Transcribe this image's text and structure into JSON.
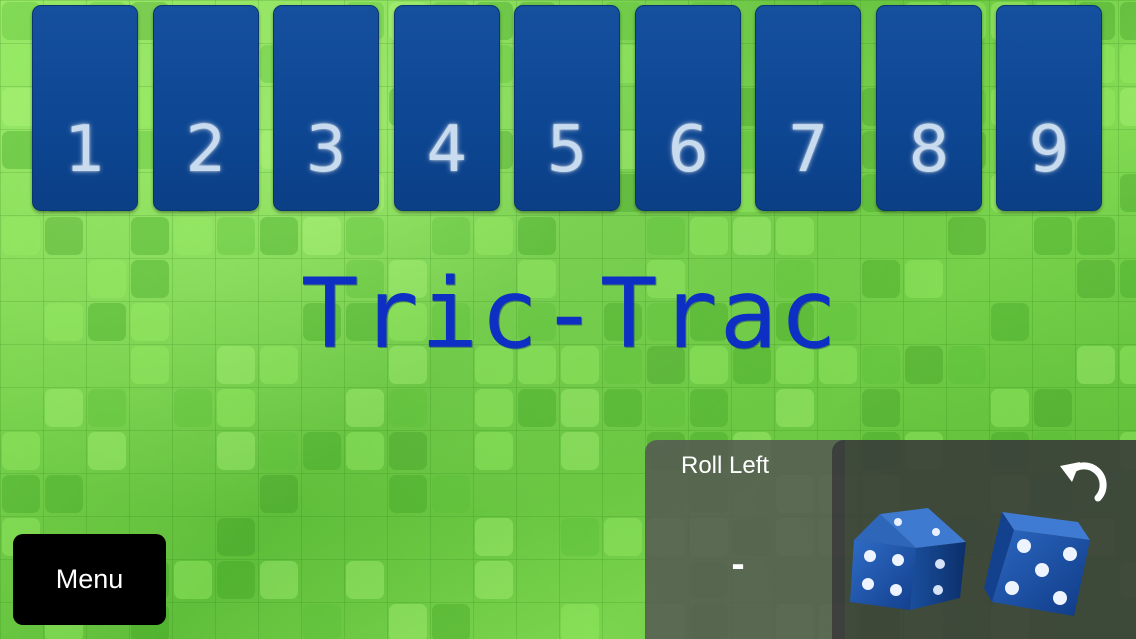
{
  "cards": [
    {
      "label": "1"
    },
    {
      "label": "2"
    },
    {
      "label": "3"
    },
    {
      "label": "4"
    },
    {
      "label": "5"
    },
    {
      "label": "6"
    },
    {
      "label": "7"
    },
    {
      "label": "8"
    },
    {
      "label": "9"
    }
  ],
  "title": "Tric-Trac",
  "menu": {
    "label": "Menu"
  },
  "roll": {
    "label": "Roll Left",
    "value": "-"
  },
  "dice": [
    {
      "value": 5
    },
    {
      "value": 5
    }
  ],
  "icons": {
    "undo": "undo-arrow-icon"
  },
  "colors": {
    "card": "#0d4692",
    "card_number": "#c9dbee",
    "title": "#0d2fc4",
    "die": "#1a56b0",
    "background": "#7ed44e"
  }
}
